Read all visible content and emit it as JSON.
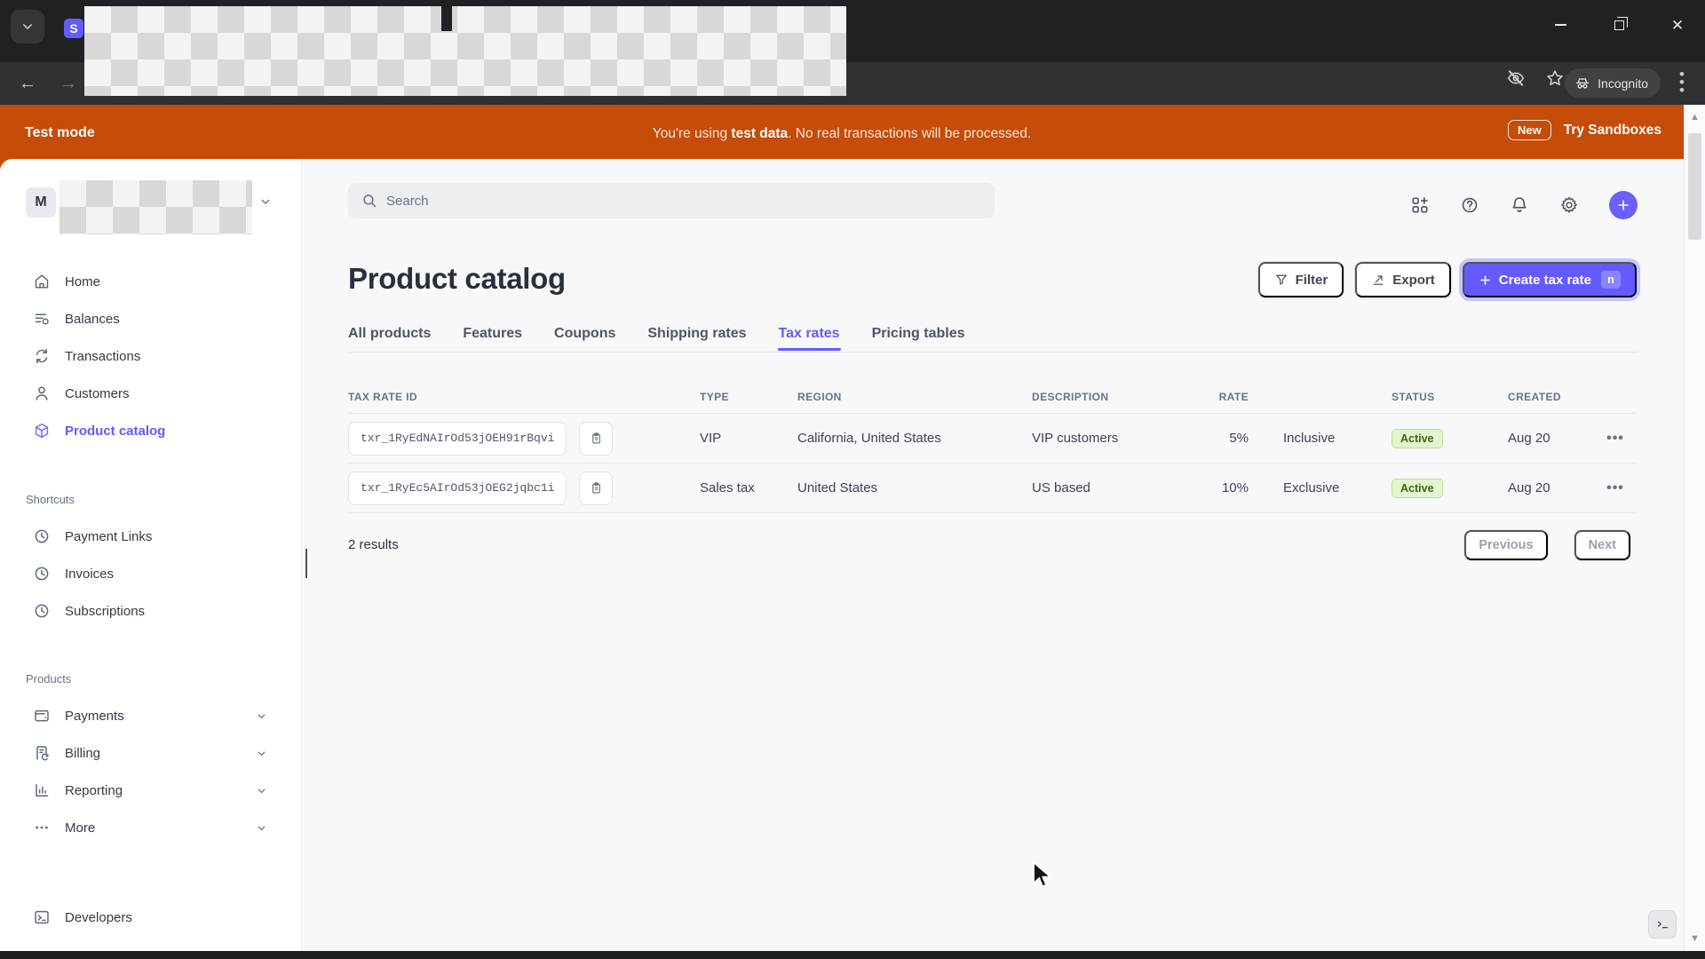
{
  "browser": {
    "tab_favicon": "S",
    "incognito_label": "Incognito"
  },
  "banner": {
    "mode_label": "Test mode",
    "message_prefix": "You're using ",
    "message_bold": "test data",
    "message_suffix": ". No real transactions will be processed.",
    "new_badge": "New",
    "cta": "Try Sandboxes"
  },
  "sidebar": {
    "account_initial": "M",
    "nav": [
      {
        "label": "Home"
      },
      {
        "label": "Balances"
      },
      {
        "label": "Transactions"
      },
      {
        "label": "Customers"
      },
      {
        "label": "Product catalog"
      }
    ],
    "shortcuts": {
      "label": "Shortcuts",
      "items": [
        {
          "label": "Payment Links"
        },
        {
          "label": "Invoices"
        },
        {
          "label": "Subscriptions"
        }
      ]
    },
    "products": {
      "label": "Products",
      "items": [
        {
          "label": "Payments"
        },
        {
          "label": "Billing"
        },
        {
          "label": "Reporting"
        },
        {
          "label": "More"
        }
      ]
    },
    "developers": {
      "label": "Developers"
    }
  },
  "header": {
    "search_placeholder": "Search"
  },
  "page": {
    "title": "Product catalog",
    "actions": {
      "filter": "Filter",
      "export": "Export",
      "create": "Create tax rate",
      "create_kbd": "n"
    },
    "tabs": [
      {
        "label": "All products"
      },
      {
        "label": "Features"
      },
      {
        "label": "Coupons"
      },
      {
        "label": "Shipping rates"
      },
      {
        "label": "Tax rates"
      },
      {
        "label": "Pricing tables"
      }
    ]
  },
  "table": {
    "columns": [
      "TAX RATE ID",
      "TYPE",
      "REGION",
      "DESCRIPTION",
      "RATE",
      "STATUS",
      "CREATED"
    ],
    "rows": [
      {
        "id": "txr_1RyEdNAIrOd53jOEH91rBqvi",
        "type": "VIP",
        "region": "California, United States",
        "description": "VIP customers",
        "rate": "5%",
        "behavior": "Inclusive",
        "status": "Active",
        "created": "Aug 20"
      },
      {
        "id": "txr_1RyEc5AIrOd53jOEG2jqbc1i",
        "type": "Sales tax",
        "region": "United States",
        "description": "US based",
        "rate": "10%",
        "behavior": "Exclusive",
        "status": "Active",
        "created": "Aug 20"
      }
    ],
    "results_count": "2 results",
    "pagination": {
      "previous": "Previous",
      "next": "Next"
    }
  },
  "colors": {
    "accent_purple": "#635bff",
    "banner_orange": "#c54c09",
    "status_active_bg": "#e2f5cd",
    "status_active_text": "#3f641a",
    "content_bg": "#f6f8fa",
    "chrome_dark": "#1f2124"
  }
}
